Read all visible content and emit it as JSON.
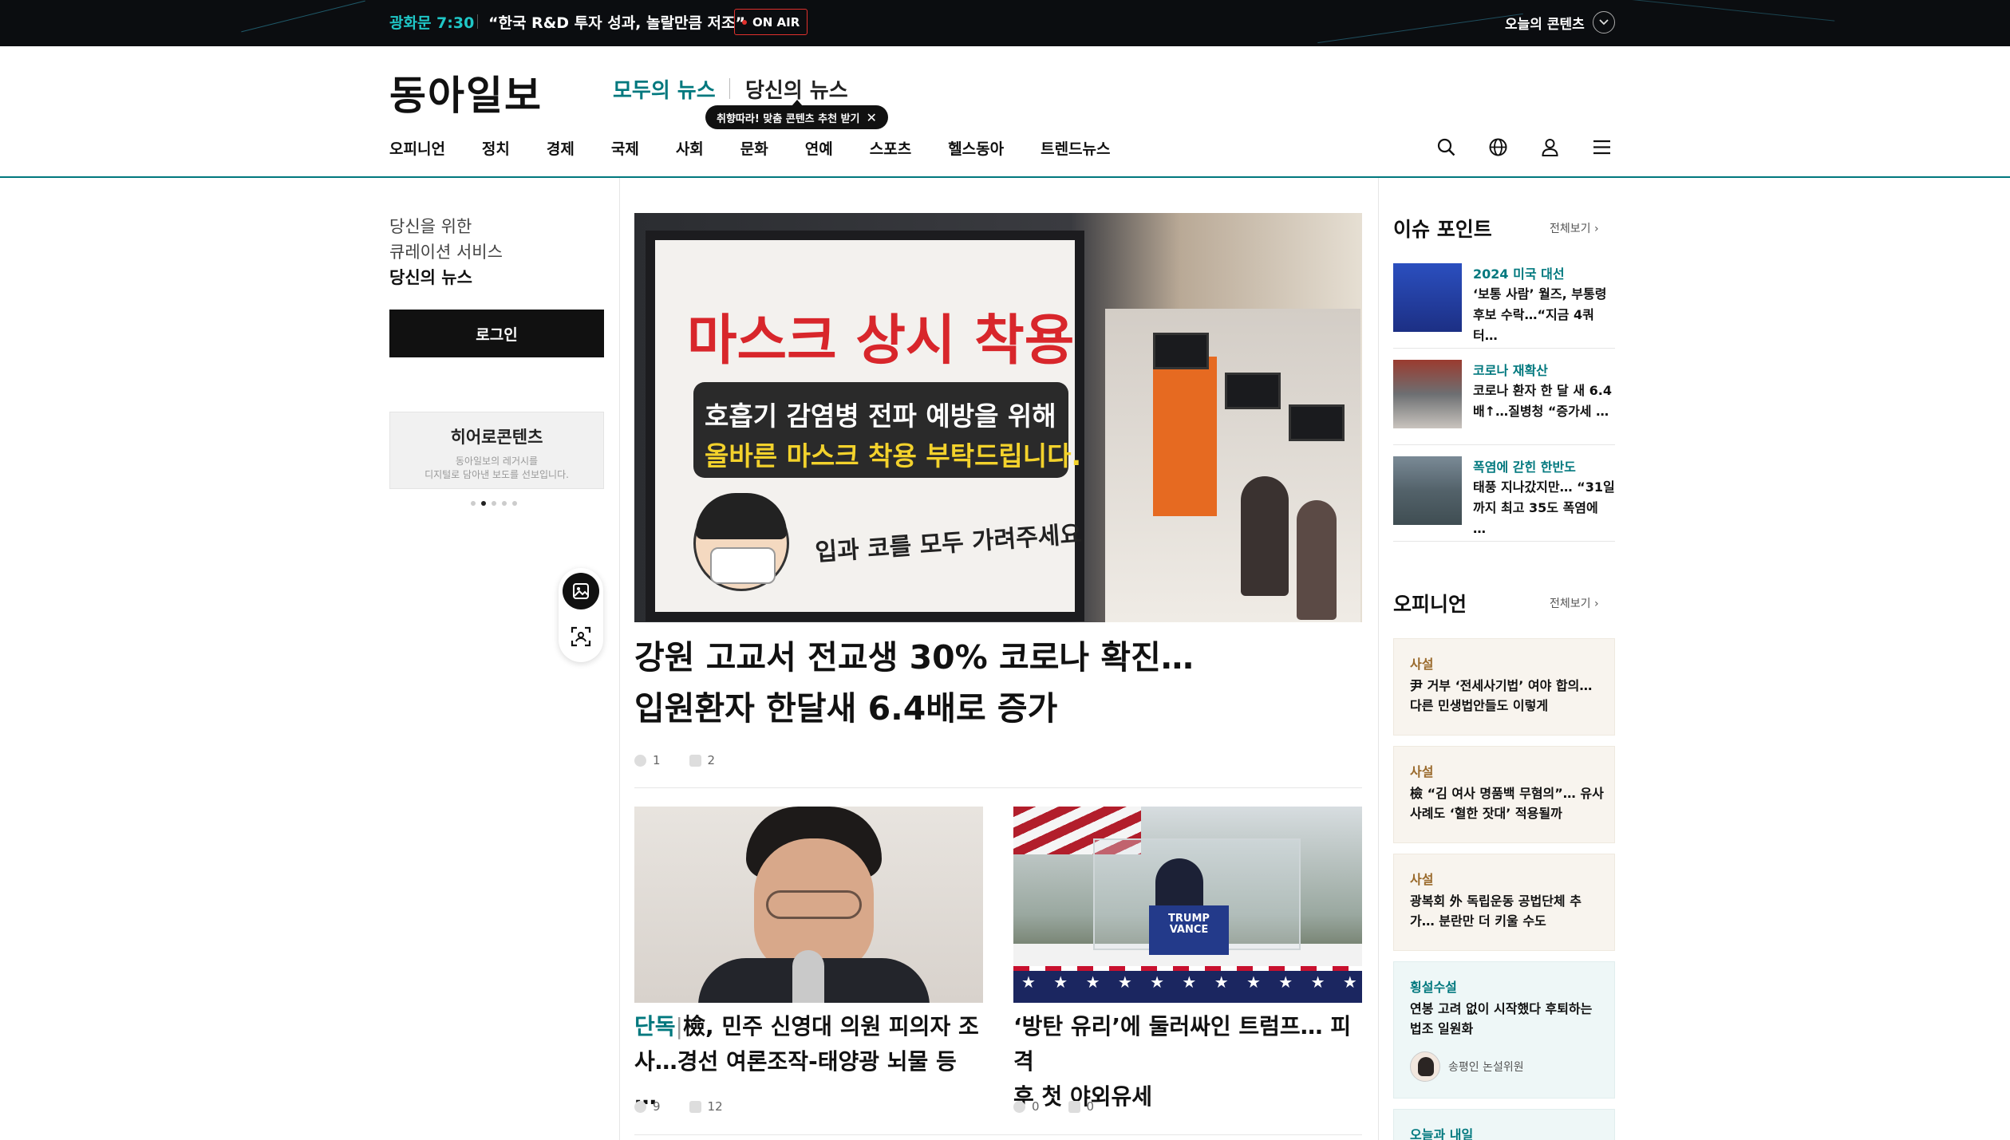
{
  "topbar": {
    "onair_time": "광화문 7:30",
    "onair_title": "“한국 R&D 투자 성과, 놀랄만큼 저조”",
    "onair_badge": "ON AIR",
    "today_content": "오늘의 콘텐츠"
  },
  "header": {
    "logo": "동아일보",
    "tab_all": "모두의 뉴스",
    "tab_my": "당신의 뉴스",
    "tooltip": "취향따라! 맞춤 콘텐츠 추천 받기",
    "nav": [
      "오피니언",
      "정치",
      "경제",
      "국제",
      "사회",
      "문화",
      "연예",
      "스포츠",
      "헬스동아",
      "트렌드뉴스"
    ],
    "icons": [
      "search-icon",
      "globe-icon",
      "user-icon",
      "menu-icon"
    ]
  },
  "left": {
    "curation_line1": "당신을 위한",
    "curation_line2": "큐레이션 서비스",
    "curation_line3": "당신의 뉴스",
    "login": "로그인",
    "hero_title": "히어로콘텐츠",
    "hero_desc1": "동아일보의 레거시를",
    "hero_desc2": "디지털로 담아낸 보도를 선보입니다."
  },
  "main": {
    "top": {
      "photo_sign_line1": "마스크 상시 착용",
      "photo_sign_line2": "호흡기 감염병 전파 예방을 위해",
      "photo_sign_line3": "올바른 마스크 착용 부탁드립니다.",
      "photo_sign_line4": "입과 코를 모두 가려주세요",
      "title_line1": "강원 고교서 전교생 30% 코로나 확진…",
      "title_line2": "입원환자 한달새 6.4배로 증가",
      "reactions": "1",
      "comments": "2"
    },
    "left_sub": {
      "label": "단독",
      "title_line1": "檢, 민주 신영대 의원 피의자 조",
      "title_line2": "사…경선 여론조작-태양광 뇌물 등 …",
      "reactions": "9",
      "comments": "12"
    },
    "right_sub": {
      "podium": "TRUMP VANCE",
      "title_line1": "‘방탄 유리’에 둘러싸인 트럼프… 피격",
      "title_line2": "후 첫 야외유세",
      "reactions": "0",
      "comments": "0"
    }
  },
  "right": {
    "issue_head": "이슈 포인트",
    "opinion_head": "오피니언",
    "more": "전체보기 ›",
    "issues": [
      {
        "cat": "2024 미국 대선",
        "line1": "‘보통 사람’ 월즈, 부통령",
        "line2": "후보 수락…“지금 4쿼터…"
      },
      {
        "cat": "코로나 재확산",
        "line1": "코로나 환자 한 달 새 6.4",
        "line2": "배↑…질병청 “증가세 …"
      },
      {
        "cat": "폭염에 갇힌 한반도",
        "line1": "태풍 지나갔지만… “31일",
        "line2": "까지 최고 35도 폭염에 …"
      }
    ],
    "opinions": [
      {
        "cat": "사설",
        "line1": "尹 거부 ‘전세사기법’ 여야 합의…",
        "line2": "다른 민생법안들도 이렇게"
      },
      {
        "cat": "사설",
        "line1": "檢 “김 여사 명품백 무혐의”… 유사",
        "line2": "사례도 ‘혈한 잣대’ 적용될까"
      },
      {
        "cat": "사설",
        "line1": "광복회 外 독립운동 공법단체 추",
        "line2": "가… 분란만 더 키울 수도"
      },
      {
        "cat": "횡설수설",
        "line1": "연봉 고려 없이 시작했다 후퇴하는",
        "line2": "법조 일원화",
        "author": "송평인 논설위원"
      },
      {
        "cat": "오늘과 내일"
      }
    ]
  },
  "colors": {
    "accent": "#00787e",
    "onair": "#e0312d",
    "editorial": "#9a6a2c"
  }
}
